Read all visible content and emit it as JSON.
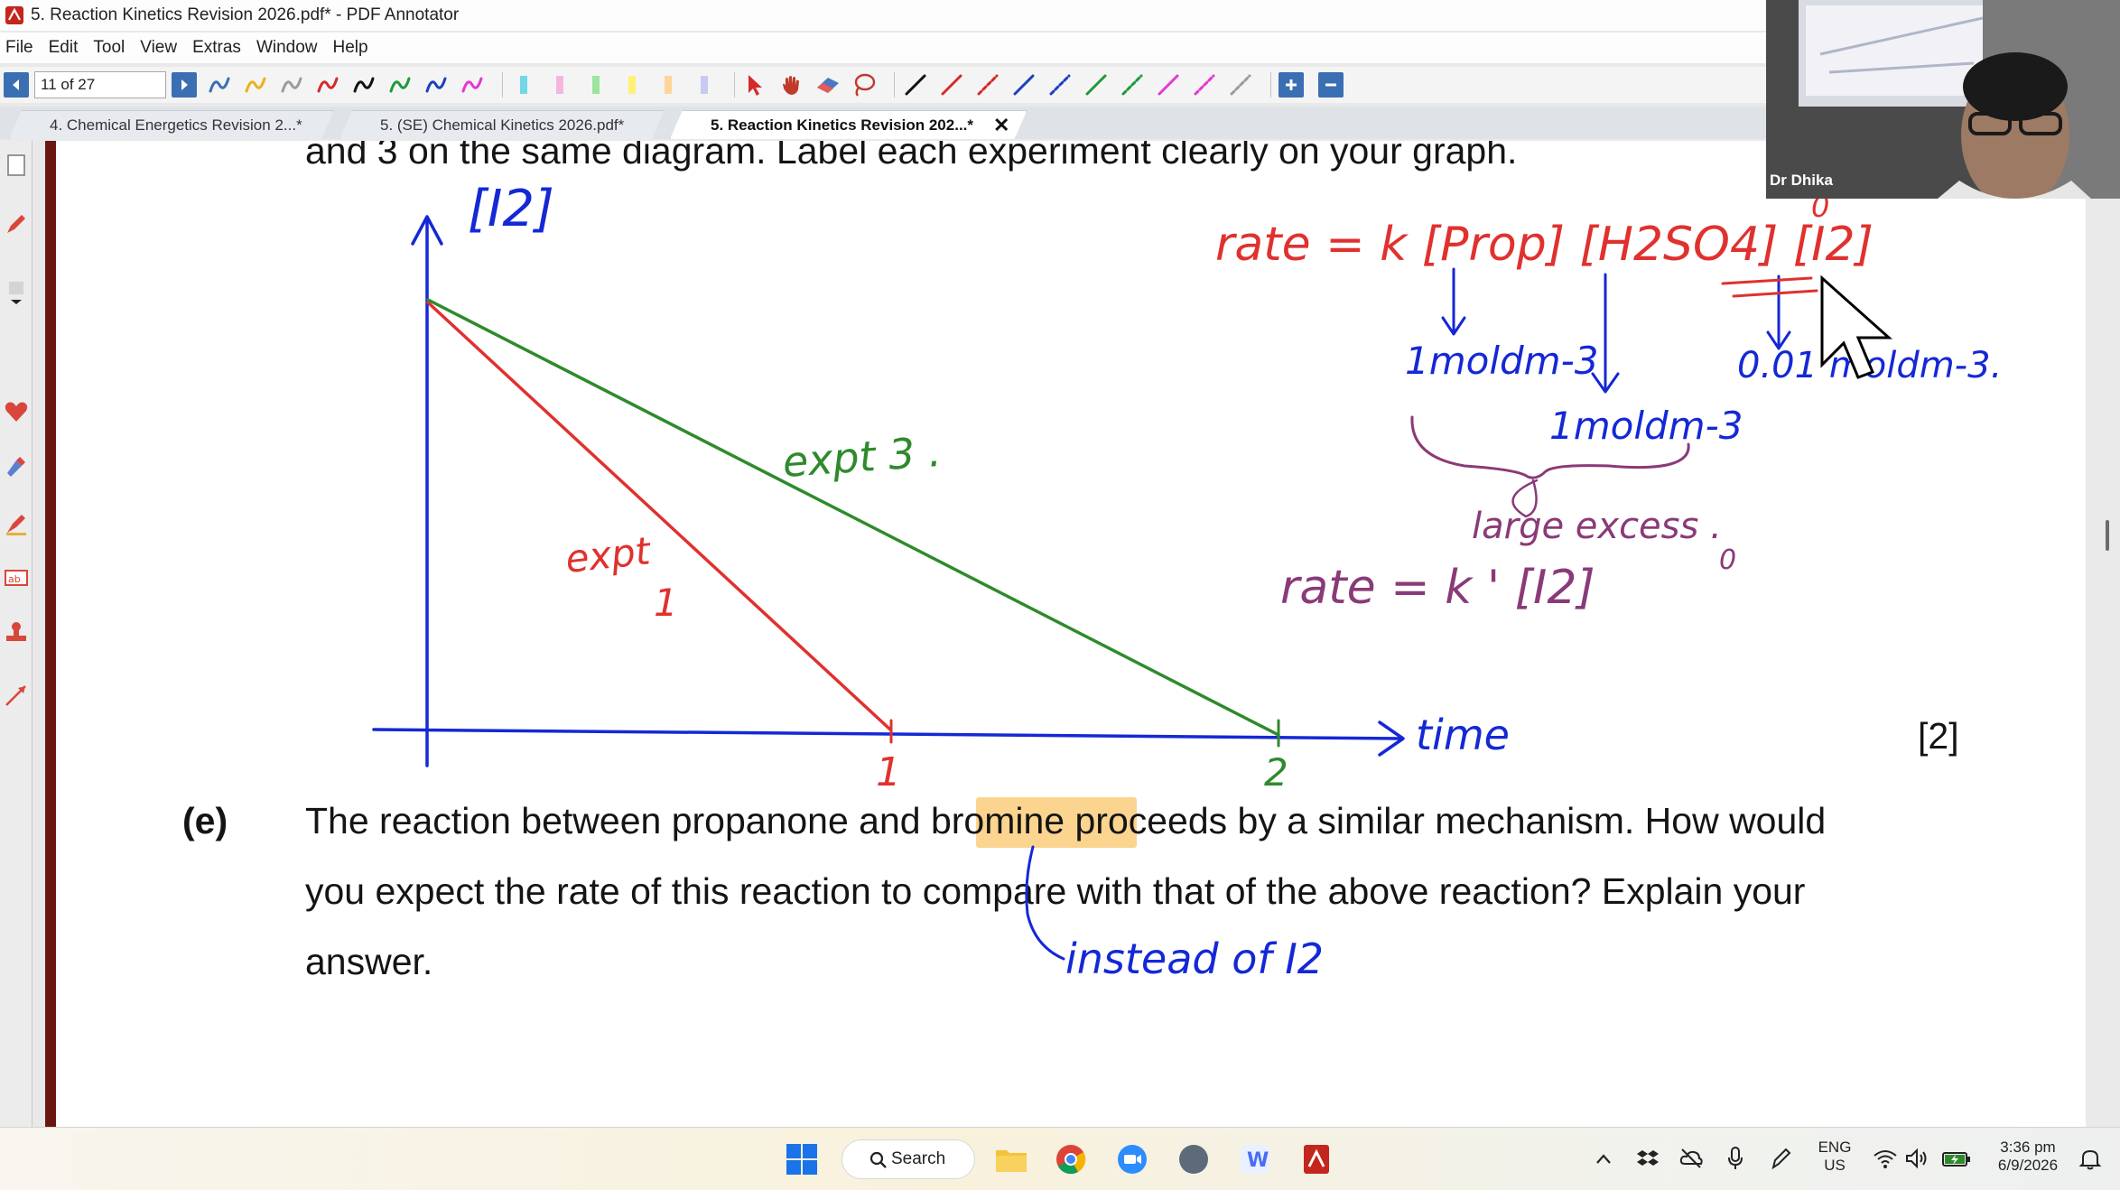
{
  "window": {
    "title": "5. Reaction Kinetics Revision 2026.pdf* - PDF Annotator"
  },
  "menu": {
    "file": "File",
    "edit": "Edit",
    "tool": "Tool",
    "view": "View",
    "extras": "Extras",
    "window": "Window",
    "help": "Help"
  },
  "toolbar": {
    "page_value": "11 of 27",
    "pen_colors": [
      "#3a6fb3",
      "#e8b11e",
      "#9b9b9b",
      "#d52a2a",
      "#111111",
      "#1c9a3a",
      "#1e3fbf",
      "#e536d6"
    ],
    "highlighter_colors": [
      "#72d7e8",
      "#f4b6de",
      "#9be59d",
      "#fff176",
      "#ffd59a",
      "#c9c9f2"
    ],
    "line_colors": [
      "#111111",
      "#d52a2a",
      "#d52a2a",
      "#1e3fbf",
      "#1e3fbf",
      "#1c9a3a",
      "#1c9a3a",
      "#e536d6",
      "#e536d6",
      "#9b9b9b"
    ]
  },
  "tabs": [
    {
      "label": "4. Chemical Energetics Revision 2...*",
      "active": false
    },
    {
      "label": "5. (SE) Chemical Kinetics 2026.pdf*",
      "active": false
    },
    {
      "label": "5. Reaction Kinetics Revision 202...*",
      "active": true,
      "close": "✕"
    }
  ],
  "document": {
    "top_line": "and 3 on the same diagram. Label each experiment clearly on your graph.",
    "marks": "[2]",
    "question_label": "(e)",
    "q_line1_pre": "The reaction between propanone and ",
    "q_line1_highlight": "bromine",
    "q_line1_post": " proceeds by a similar mechanism. How would",
    "q_line2": "you expect the rate of this reaction to compare with that of the above reaction? Explain your",
    "q_line3": "answer."
  },
  "handwriting": {
    "y_axis": "[I2]",
    "x_axis": "time",
    "tick_1": "1",
    "tick_2": "2",
    "expt1_a": "expt",
    "expt1_b": "1",
    "expt3": "expt 3 .",
    "rate_eq": "rate = k [Prop] [H2SO4] [I2]",
    "power_zero": "0",
    "conc_prop": "1moldm-3",
    "conc_acid": "1moldm-3",
    "conc_i2": "0.01 moldm-3.",
    "large_excess": "large excess .",
    "rate_prime": "rate =  k ' [I2]",
    "power_zero_2": "0",
    "instead": "instead of I2"
  },
  "video": {
    "participant": "Dr Dhika"
  },
  "taskbar": {
    "search": "Search",
    "lang_top": "ENG",
    "lang_bottom": "US",
    "time": "3:36 pm",
    "date": "6/9/2026"
  },
  "colors": {
    "ink_blue": "#1428d6",
    "ink_red": "#e0312e",
    "ink_green": "#2f8a2c",
    "ink_purple": "#8a3a78",
    "highlight": "#fbd48f"
  }
}
